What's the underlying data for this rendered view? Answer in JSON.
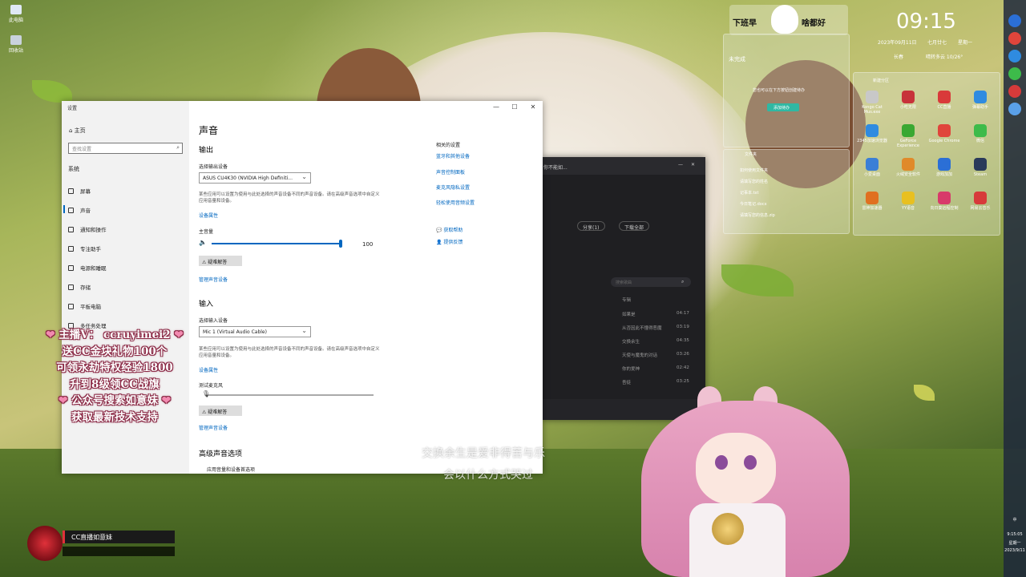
{
  "desktop": {
    "icons": [
      "此电脑",
      "回收站"
    ]
  },
  "settings_window": {
    "title": "设置",
    "controls": [
      "—",
      "☐",
      "✕"
    ],
    "home_label": "主页",
    "search_placeholder": "查找设置",
    "section_label": "系统",
    "nav_items": [
      "屏幕",
      "声音",
      "通知和操作",
      "专注助手",
      "电源和睡眠",
      "存储",
      "平板电脑",
      "多任务处理"
    ],
    "page_title": "声音",
    "output": {
      "heading": "输出",
      "select_label": "选择输出设备",
      "device": "ASUS CU4K30 (NVIDIA High Definiti...",
      "desc": "某些应用可以设置为使用与此处选择的声音设备不同的声音设备。请在高级声音选项中自定义应用音量和设备。",
      "device_props": "设备属性",
      "volume_label": "主音量",
      "volume_value": "100",
      "volume_level": 100,
      "troubleshoot": "疑难解答",
      "manage": "管理声音设备"
    },
    "input": {
      "heading": "输入",
      "select_label": "选择输入设备",
      "device": "Mic 1 (Virtual Audio Cable)",
      "desc": "某些应用可以设置为使用与此处选择的声音设备不同的声音设备。请在高级声音选项中自定义应用音量和设备。",
      "device_props": "设备属性",
      "test_label": "测试麦克风",
      "troubleshoot": "疑难解答",
      "manage": "管理声音设备"
    },
    "advanced": {
      "heading": "高级声音选项",
      "item": "应用音量和设备首选项"
    },
    "related": {
      "heading": "相关的设置",
      "links": [
        "蓝牙和其他设备",
        "声音控制面板",
        "麦克风隐私设置",
        "轻松使用音频设置"
      ],
      "help": "获取帮助",
      "feedback": "提供反馈"
    }
  },
  "music_app": {
    "title_text": "你不能如...",
    "share": "分享(1)",
    "download": "下载全部",
    "search_placeholder": "搜索歌曲",
    "col_album": "专辑",
    "rows": [
      {
        "title": "...",
        "album": "如果是",
        "time": "04:17"
      },
      {
        "title": "...",
        "album": "从否因此不懂得恶魔",
        "time": "03:19"
      },
      {
        "title": "...",
        "album": "交换余生",
        "time": "04:35"
      },
      {
        "title": "...",
        "album": "天使与魔鬼的对话",
        "time": "03:26"
      },
      {
        "title": "...",
        "album": "你的爱神",
        "time": "02:42"
      },
      {
        "title": "...",
        "album": "吾徒",
        "time": "03:25"
      }
    ]
  },
  "brand_banner": {
    "left": "下班早",
    "right": "啥都好"
  },
  "clock": {
    "time": "09:15",
    "date": "2023年09月11日",
    "lunar": "七月廿七",
    "weekday": "星期一",
    "city": "长春",
    "weather": "晴转多云 10/26°"
  },
  "widget_todo": {
    "title": "未完成",
    "hint": "您也可以在下方按钮创建待办",
    "btn": "添加待办"
  },
  "widget_files": {
    "title": "文件夹",
    "files": [
      "如何使用文件夹",
      "请填写您的姓名",
      "记事本.txt",
      "今日笔记.docx",
      "请填写您的信息.zip"
    ]
  },
  "widget_apps": {
    "title": "新建分区",
    "apps": [
      "Kongo Cat Mus.exe",
      "小吃无限",
      "CC直播",
      "弹幕助手",
      "2345加速浏览器",
      "GeForce Experience",
      "Google Chrome",
      "微信",
      "小爱桌面",
      "火绒安全软件",
      "游戏加加",
      "Steam",
      "雷神加速器",
      "YY语音",
      "向日葵远程控制",
      "网易云音乐"
    ]
  },
  "taskbar": {
    "time": "9:15:05",
    "weekday": "星期一",
    "date": "2023/9/11",
    "ime": "中"
  },
  "overlay": {
    "lines": [
      "主播V： ccruyimei2",
      "送CC金块礼物100个",
      "可领永劫特权经验1800",
      "升到8级领CC战旗",
      "公众号搜索如意妹",
      "获取最新技术支持"
    ],
    "cc_name": "CC直播如意妹"
  },
  "subtitle": {
    "line1": "交换余生是爱非得苦与乐",
    "line2": "会以什么方式哭过"
  }
}
